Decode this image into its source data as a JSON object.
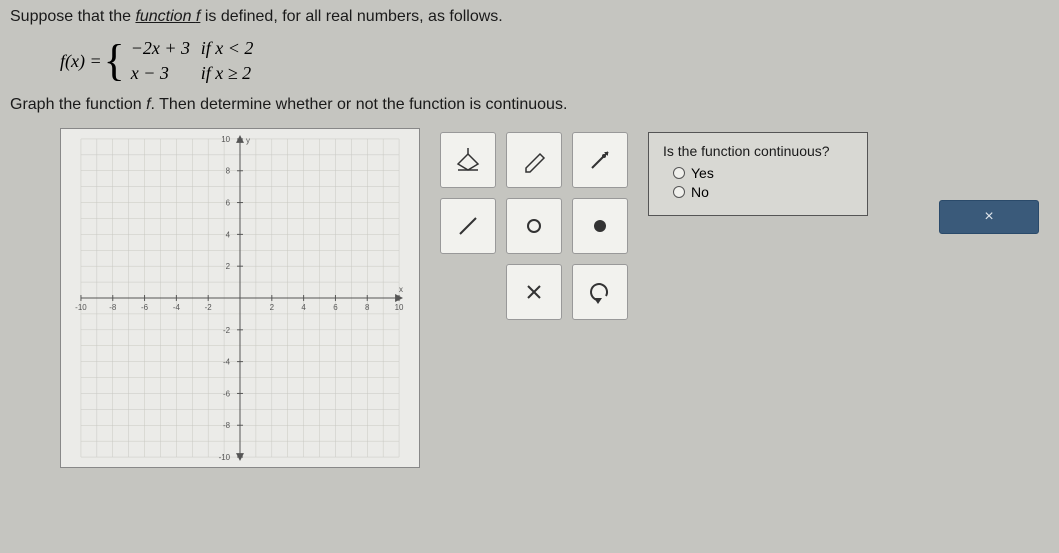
{
  "problem_intro": "Suppose that the ",
  "func_word": "function ",
  "func_letter": "f",
  "problem_intro_tail": " is defined, for all real numbers, as follows.",
  "fx_label": "f(x) = ",
  "piece1_expr": "−2x + 3",
  "piece1_cond": "if x < 2",
  "piece2_expr": "x − 3",
  "piece2_cond": "if x ≥ 2",
  "prompt2_a": "Graph the function ",
  "prompt2_f": "f",
  "prompt2_b": ". Then determine whether or not the function is continuous.",
  "question_title": "Is the function continuous?",
  "answer_yes": "Yes",
  "answer_no": "No",
  "close_x": "×",
  "tool_names": {
    "fill": "fill-tool-icon",
    "pen": "pen-tool-icon",
    "ray": "ray-tool-icon",
    "segment": "segment-tool-icon",
    "open_pt": "open-point-icon",
    "closed_pt": "closed-point-icon",
    "delete": "delete-icon",
    "undo": "undo-icon"
  },
  "chart_data": {
    "type": "scatter",
    "title": "",
    "xlabel": "x",
    "ylabel": "y",
    "xlim": [
      -10,
      10
    ],
    "ylim": [
      -10,
      10
    ],
    "xticks": [
      -10,
      -8,
      -6,
      -4,
      -2,
      2,
      4,
      6,
      8,
      10
    ],
    "yticks": [
      -10,
      -8,
      -6,
      -4,
      -2,
      2,
      4,
      6,
      8,
      10
    ],
    "series": []
  }
}
